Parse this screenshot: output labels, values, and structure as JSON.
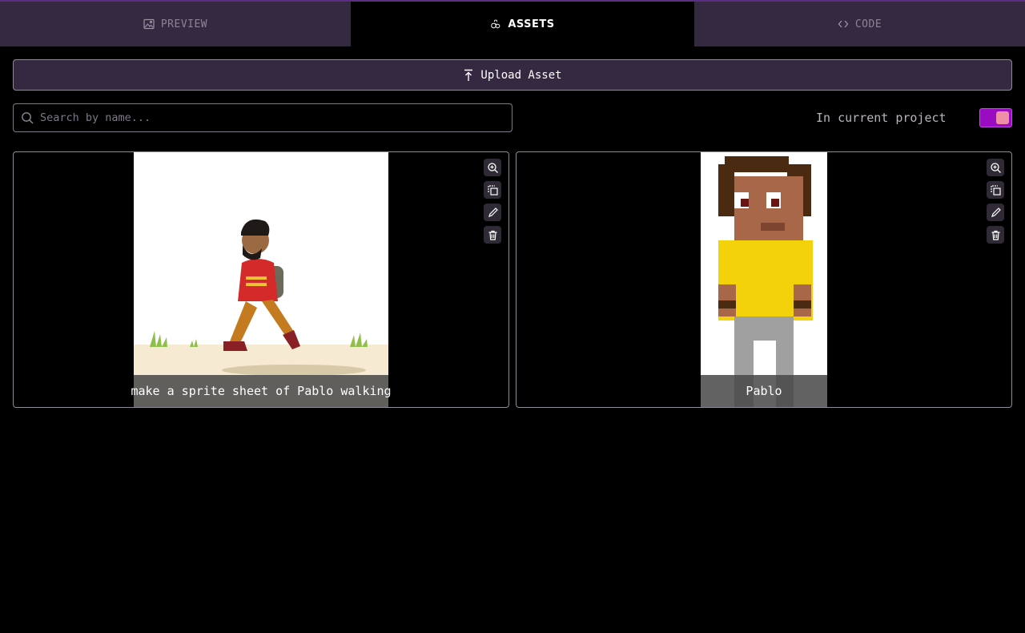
{
  "tabs": [
    {
      "label": "PREVIEW",
      "icon": "image-icon",
      "active": false
    },
    {
      "label": "ASSETS",
      "icon": "assets-icon",
      "active": true
    },
    {
      "label": "CODE",
      "icon": "code-icon",
      "active": false
    }
  ],
  "upload": {
    "label": "Upload Asset",
    "icon": "upload-icon"
  },
  "search": {
    "placeholder": "Search by name...",
    "value": "",
    "icon": "search-icon"
  },
  "filter": {
    "label": "In current project",
    "toggle_on": true
  },
  "colors": {
    "accent": "#9a0cc2",
    "tab_bg": "#352841",
    "knob": "#ef8fa6"
  },
  "assets": [
    {
      "caption": "make a sprite sheet of Pablo walking",
      "actions": [
        "zoom-in-icon",
        "copy-icon",
        "edit-icon",
        "trash-icon"
      ]
    },
    {
      "caption": "Pablo",
      "actions": [
        "zoom-in-icon",
        "copy-icon",
        "edit-icon",
        "trash-icon"
      ]
    }
  ]
}
